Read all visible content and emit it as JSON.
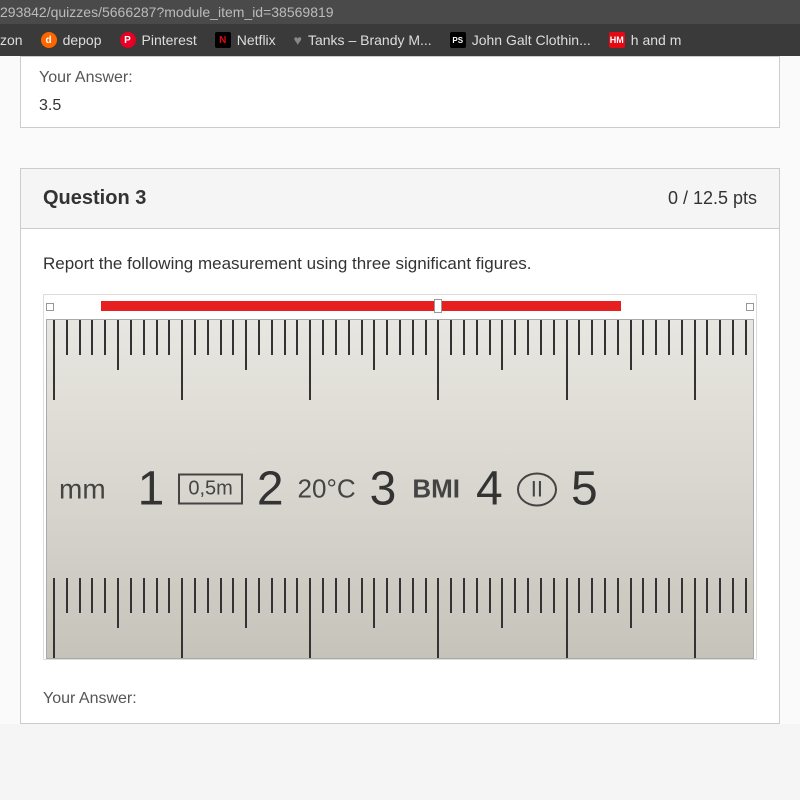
{
  "url": "293842/quizzes/5666287?module_item_id=38569819",
  "bookmarks": [
    {
      "label": "zon",
      "icon": "",
      "iconClass": ""
    },
    {
      "label": "depop",
      "icon": "d",
      "iconClass": "icon-orange"
    },
    {
      "label": "Pinterest",
      "icon": "P",
      "iconClass": "icon-red"
    },
    {
      "label": "Netflix",
      "icon": "N",
      "iconClass": "icon-netflix"
    },
    {
      "label": "Tanks – Brandy M...",
      "icon": "♥",
      "iconClass": "icon-heart"
    },
    {
      "label": "John Galt Clothin...",
      "icon": "PS",
      "iconClass": "icon-ps"
    },
    {
      "label": "h and m",
      "icon": "HM",
      "iconClass": "icon-hm"
    }
  ],
  "prevAnswer": {
    "label": "Your Answer:",
    "value": "3.5"
  },
  "question": {
    "title": "Question 3",
    "points": "0 / 12.5 pts",
    "prompt": "Report the following measurement using three significant figures."
  },
  "ruler": {
    "unit": "mm",
    "num1": "1",
    "box": "0,5m",
    "num2": "2",
    "temp": "20°C",
    "num3": "3",
    "bmi": "BMI",
    "num4": "4",
    "oval": "II",
    "num5": "5"
  },
  "bottomAnswer": "Your Answer:"
}
